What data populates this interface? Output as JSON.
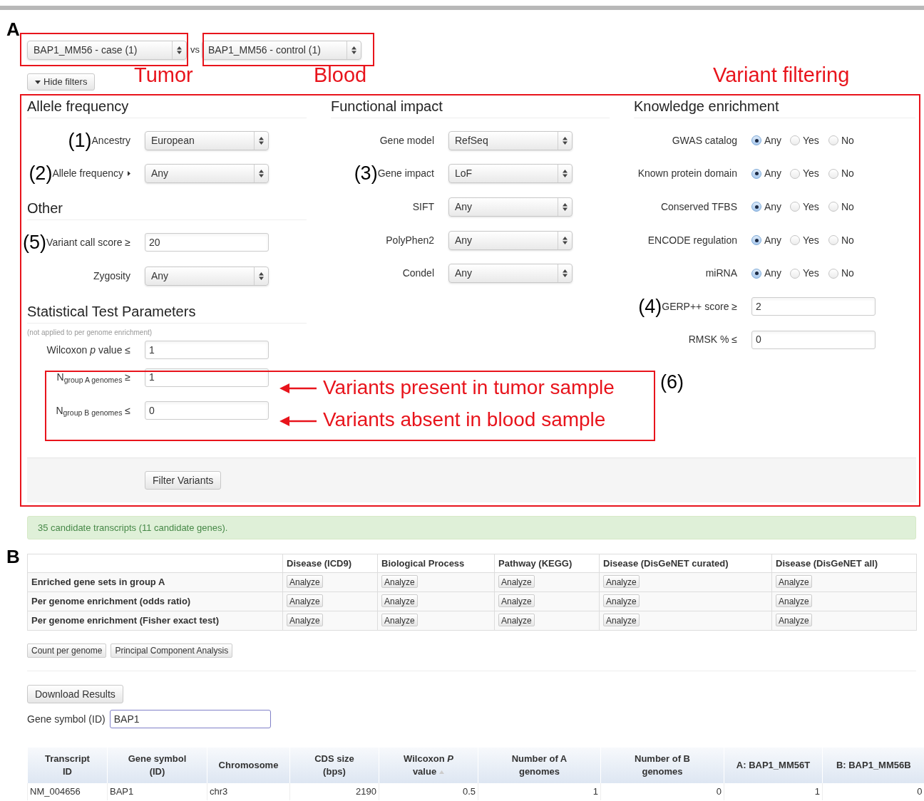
{
  "panel_labels": [
    "A",
    "B"
  ],
  "comparison": {
    "case_select": "BAP1_MM56 - case (1)",
    "separator": "vs",
    "control_select": "BAP1_MM56 - control (1)"
  },
  "hide_filters_button": "Hide filters",
  "columns": [
    {
      "sections": [
        {
          "title": "Allele frequency",
          "fields": [
            {
              "kind": "select",
              "label": "Ancestry",
              "value": "European",
              "marker": "(1)"
            },
            {
              "kind": "select",
              "label": "Allele frequency",
              "value": "Any",
              "marker": "(2)",
              "caret": true
            }
          ]
        },
        {
          "title": "Other",
          "fields": [
            {
              "kind": "text",
              "label": "Variant call score ≥",
              "value": "20",
              "marker": "(5)"
            },
            {
              "kind": "select",
              "label": "Zygosity",
              "value": "Any"
            }
          ]
        },
        {
          "title": "Statistical Test Parameters",
          "note": "(not applied to per genome enrichment)",
          "fields": [
            {
              "kind": "text",
              "label": "Wilcoxon *p* value ≤",
              "value": "1"
            },
            {
              "kind": "text",
              "label": "N$_{group A genomes}$ ≥",
              "value": "1"
            },
            {
              "kind": "text",
              "label": "N$_{group B genomes}$ ≤",
              "value": "0"
            }
          ]
        }
      ]
    },
    {
      "sections": [
        {
          "title": "Functional impact",
          "fields": [
            {
              "kind": "select",
              "label": "Gene model",
              "value": "RefSeq"
            },
            {
              "kind": "select",
              "label": "Gene impact",
              "value": "LoF",
              "marker": "(3)"
            },
            {
              "kind": "select",
              "label": "SIFT",
              "value": "Any"
            },
            {
              "kind": "select",
              "label": "PolyPhen2",
              "value": "Any"
            },
            {
              "kind": "select",
              "label": "Condel",
              "value": "Any"
            }
          ]
        }
      ]
    },
    {
      "sections": [
        {
          "title": "Knowledge enrichment",
          "fields": [
            {
              "kind": "radio",
              "label": "GWAS catalog",
              "options": [
                {
                  "label": "Any",
                  "selected": true
                },
                {
                  "label": "Yes",
                  "selected": false
                },
                {
                  "label": "No",
                  "selected": false
                }
              ]
            },
            {
              "kind": "radio",
              "label": "Known protein domain",
              "options": [
                {
                  "label": "Any",
                  "selected": true
                },
                {
                  "label": "Yes",
                  "selected": false
                },
                {
                  "label": "No",
                  "selected": false
                }
              ]
            },
            {
              "kind": "radio",
              "label": "Conserved TFBS",
              "options": [
                {
                  "label": "Any",
                  "selected": true
                },
                {
                  "label": "Yes",
                  "selected": false
                },
                {
                  "label": "No",
                  "selected": false
                }
              ]
            },
            {
              "kind": "radio",
              "label": "ENCODE regulation",
              "options": [
                {
                  "label": "Any",
                  "selected": true
                },
                {
                  "label": "Yes",
                  "selected": false
                },
                {
                  "label": "No",
                  "selected": false
                }
              ]
            },
            {
              "kind": "radio",
              "label": "miRNA",
              "options": [
                {
                  "label": "Any",
                  "selected": true
                },
                {
                  "label": "Yes",
                  "selected": false
                },
                {
                  "label": "No",
                  "selected": false
                }
              ]
            },
            {
              "kind": "text",
              "label": "GERP++ score ≥",
              "value": "2",
              "marker": "(4)"
            },
            {
              "kind": "text",
              "label": "RMSK % ≤",
              "value": "0"
            }
          ]
        }
      ]
    }
  ],
  "filter_button": "Filter Variants",
  "annotations": {
    "tumor": "Tumor",
    "blood": "Blood",
    "variant_filtering": "Variant filtering",
    "present_note": "Variants present in tumor sample",
    "absent_note": "Variants absent in blood sample",
    "group_marker": "(6)"
  },
  "result_alert": "35 candidate transcripts (11 candidate genes).",
  "enrichment_table": {
    "columns": [
      "Disease (ICD9)",
      "Biological Process",
      "Pathway (KEGG)",
      "Disease (DisGeNET curated)",
      "Disease (DisGeNET all)"
    ],
    "rows": [
      {
        "label": "Enriched gene sets in group A",
        "buttons": [
          "Analyze",
          "Analyze",
          "Analyze",
          "Analyze",
          "Analyze"
        ]
      },
      {
        "label": "Per genome enrichment (odds ratio)",
        "buttons": [
          "Analyze",
          "Analyze",
          "Analyze",
          "Analyze",
          "Analyze"
        ]
      },
      {
        "label": "Per genome enrichment (Fisher exact test)",
        "buttons": [
          "Analyze",
          "Analyze",
          "Analyze",
          "Analyze",
          "Analyze"
        ]
      }
    ]
  },
  "analysis_buttons": [
    "Count per genome",
    "Principal Component Analysis"
  ],
  "download_button": "Download Results",
  "gene_filter": {
    "label": "Gene symbol (ID)",
    "value": "BAP1"
  },
  "results_table": {
    "columns": [
      {
        "label": "Transcript ID",
        "sorted": false
      },
      {
        "label": "Gene symbol (ID)",
        "sorted": false
      },
      {
        "label": "Chromosome",
        "sorted": false
      },
      {
        "label": "CDS size (bps)",
        "sorted": false
      },
      {
        "label": "Wilcoxon *P* value",
        "sorted": true
      },
      {
        "label": "Number of A genomes",
        "sorted": false
      },
      {
        "label": "Number of B genomes",
        "sorted": false
      },
      {
        "label": "A: BAP1_MM56T",
        "sorted": false
      },
      {
        "label": "B: BAP1_MM56B",
        "sorted": false
      }
    ],
    "rows": [
      [
        "NM_004656",
        "BAP1",
        "chr3",
        "2190",
        "0.5",
        "1",
        "0",
        "1",
        "0"
      ]
    ]
  }
}
